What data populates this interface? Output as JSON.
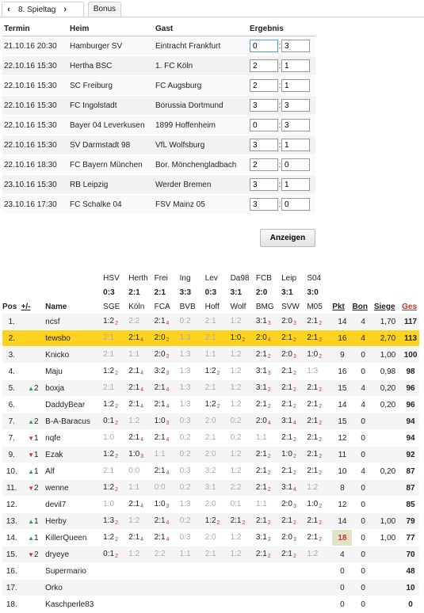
{
  "tabs": {
    "prev_icon": "‹",
    "matchday": "8. Spieltag",
    "next_icon": "›",
    "bonus": "Bonus"
  },
  "fixtures": {
    "headers": [
      "Termin",
      "Heim",
      "Gast",
      "Ergebnis"
    ],
    "rows": [
      {
        "date": "21.10.16 20:30",
        "home": "Hamburger SV",
        "away": "Eintracht Frankfurt",
        "h": "0",
        "a": "3"
      },
      {
        "date": "22.10.16 15:30",
        "home": "Hertha BSC",
        "away": "1. FC Köln",
        "h": "2",
        "a": "1"
      },
      {
        "date": "22.10.16 15:30",
        "home": "SC Freiburg",
        "away": "FC Augsburg",
        "h": "2",
        "a": "1"
      },
      {
        "date": "22.10.16 15:30",
        "home": "FC Ingolstadt",
        "away": "Borussia Dortmund",
        "h": "3",
        "a": "3"
      },
      {
        "date": "22.10.16 15:30",
        "home": "Bayer 04 Leverkusen",
        "away": "1899 Hoffenheim",
        "h": "0",
        "a": "3"
      },
      {
        "date": "22.10.16 15:30",
        "home": "SV Darmstadt 98",
        "away": "VfL Wolfsburg",
        "h": "3",
        "a": "1"
      },
      {
        "date": "22.10.16 18:30",
        "home": "FC Bayern München",
        "away": "Bor. Mönchengladbach",
        "h": "2",
        "a": "0"
      },
      {
        "date": "23.10.16 15:30",
        "home": "RB Leipzig",
        "away": "Werder Bremen",
        "h": "3",
        "a": "1"
      },
      {
        "date": "23.10.16 17:30",
        "home": "FC Schalke 04",
        "away": "FSV Mainz 05",
        "h": "3",
        "a": "0"
      }
    ],
    "submit": "Anzeigen"
  },
  "standings": {
    "match_headers": [
      {
        "t1": "HSV",
        "t2": "0:3",
        "t3": "SGE"
      },
      {
        "t1": "Herth",
        "t2": "2:1",
        "t3": "Köln"
      },
      {
        "t1": "Frei",
        "t2": "2:1",
        "t3": "FCA"
      },
      {
        "t1": "Ing",
        "t2": "3:3",
        "t3": "BVB"
      },
      {
        "t1": "Lev",
        "t2": "0:3",
        "t3": "Hoff"
      },
      {
        "t1": "Da98",
        "t2": "3:1",
        "t3": "Wolf"
      },
      {
        "t1": "FCB",
        "t2": "2:0",
        "t3": "BMG"
      },
      {
        "t1": "Leip",
        "t2": "3:1",
        "t3": "SVW"
      },
      {
        "t1": "S04",
        "t2": "3:0",
        "t3": "M05"
      }
    ],
    "col_pos": "Pos",
    "col_trend": "+/-",
    "col_name": "Name",
    "col_pkt": "Pkt",
    "col_bon": "Bon",
    "col_siege": "Siege",
    "col_ges": "Ges",
    "rows": [
      {
        "pos": "1.",
        "tr": "",
        "td": "",
        "name": "ncsf",
        "t": [
          [
            "1:2",
            "2",
            0
          ],
          [
            "2:2",
            "",
            1
          ],
          [
            "2:1",
            "4",
            0
          ],
          [
            "0:2",
            "",
            1
          ],
          [
            "2:1",
            "",
            1
          ],
          [
            "1:2",
            "",
            1
          ],
          [
            "3:1",
            "3",
            0
          ],
          [
            "2:0",
            "3",
            0
          ],
          [
            "2:1",
            "2",
            0
          ]
        ],
        "pkt": "14",
        "bon": "4",
        "siege": "1,70",
        "ges": "117"
      },
      {
        "pos": "2.",
        "tr": "",
        "td": "",
        "name": "tewsbo",
        "hl": true,
        "t": [
          [
            "2:1",
            "",
            1
          ],
          [
            "2:1",
            "4",
            0
          ],
          [
            "2:0",
            "2",
            0
          ],
          [
            "1:3",
            "",
            1
          ],
          [
            "2:1",
            "",
            1
          ],
          [
            "1:0",
            "2",
            0
          ],
          [
            "2:0",
            "4",
            0
          ],
          [
            "2:1",
            "2",
            0
          ],
          [
            "2:1",
            "2",
            0
          ]
        ],
        "pkt": "16",
        "bon": "4",
        "siege": "2,70",
        "ges": "113"
      },
      {
        "pos": "3.",
        "tr": "",
        "td": "",
        "name": "Knicko",
        "t": [
          [
            "2:1",
            "",
            1
          ],
          [
            "1:1",
            "",
            1
          ],
          [
            "2:0",
            "2",
            0
          ],
          [
            "1:3",
            "",
            1
          ],
          [
            "1:1",
            "",
            1
          ],
          [
            "1:2",
            "",
            1
          ],
          [
            "2:1",
            "2",
            0
          ],
          [
            "2:0",
            "3",
            0
          ],
          [
            "1:0",
            "2",
            0
          ]
        ],
        "pkt": "9",
        "bon": "0",
        "siege": "1,00",
        "ges": "100"
      },
      {
        "pos": "4.",
        "tr": "",
        "td": "",
        "name": "Maju",
        "t": [
          [
            "1:2",
            "2",
            0
          ],
          [
            "2:1",
            "4",
            0
          ],
          [
            "3:2",
            "3",
            0
          ],
          [
            "1:3",
            "",
            1
          ],
          [
            "1:2",
            "2",
            0
          ],
          [
            "1:2",
            "",
            1
          ],
          [
            "3:1",
            "3",
            0
          ],
          [
            "2:1",
            "2",
            0
          ],
          [
            "1:3",
            "",
            1
          ]
        ],
        "pkt": "16",
        "bon": "0",
        "siege": "0,98",
        "ges": "98"
      },
      {
        "pos": "5.",
        "tr": "up",
        "td": "2",
        "name": "boxja",
        "t": [
          [
            "2:1",
            "",
            1
          ],
          [
            "2:1",
            "4",
            0
          ],
          [
            "2:1",
            "4",
            0
          ],
          [
            "1:3",
            "",
            1
          ],
          [
            "2:1",
            "",
            1
          ],
          [
            "1:2",
            "",
            1
          ],
          [
            "3:1",
            "2",
            0
          ],
          [
            "2:1",
            "2",
            0
          ],
          [
            "2:1",
            "2",
            0
          ]
        ],
        "pkt": "15",
        "bon": "4",
        "siege": "0,20",
        "ges": "96"
      },
      {
        "pos": "6.",
        "tr": "",
        "td": "",
        "name": "DaddyBear",
        "t": [
          [
            "1:2",
            "2",
            0
          ],
          [
            "2:1",
            "4",
            0
          ],
          [
            "2:1",
            "4",
            0
          ],
          [
            "1:3",
            "",
            1
          ],
          [
            "1:2",
            "2",
            0
          ],
          [
            "1:2",
            "",
            1
          ],
          [
            "2:1",
            "2",
            0
          ],
          [
            "2:1",
            "2",
            0
          ],
          [
            "2:1",
            "2",
            0
          ]
        ],
        "pkt": "14",
        "bon": "4",
        "siege": "0,20",
        "ges": "96"
      },
      {
        "pos": "7.",
        "tr": "up",
        "td": "2",
        "name": "B-A-Baracus",
        "t": [
          [
            "0:1",
            "2",
            0
          ],
          [
            "1:2",
            "",
            1
          ],
          [
            "1:0",
            "3",
            0
          ],
          [
            "0:3",
            "",
            1
          ],
          [
            "2:0",
            "",
            1
          ],
          [
            "0:2",
            "",
            1
          ],
          [
            "2:0",
            "4",
            0
          ],
          [
            "3:1",
            "4",
            0
          ],
          [
            "2:1",
            "2",
            0
          ]
        ],
        "pkt": "15",
        "bon": "0",
        "siege": "",
        "ges": "94"
      },
      {
        "pos": "7.",
        "tr": "dn",
        "td": "1",
        "name": "nqfe",
        "t": [
          [
            "1:0",
            "",
            1
          ],
          [
            "2:1",
            "4",
            0
          ],
          [
            "2:1",
            "4",
            0
          ],
          [
            "0:2",
            "",
            1
          ],
          [
            "2:1",
            "",
            1
          ],
          [
            "0:2",
            "",
            1
          ],
          [
            "1:1",
            "",
            1
          ],
          [
            "2:1",
            "2",
            0
          ],
          [
            "2:1",
            "2",
            0
          ]
        ],
        "pkt": "12",
        "bon": "0",
        "siege": "",
        "ges": "94"
      },
      {
        "pos": "9.",
        "tr": "dn",
        "td": "1",
        "name": "Ezak",
        "t": [
          [
            "1:2",
            "2",
            0
          ],
          [
            "1:0",
            "3",
            0
          ],
          [
            "1:1",
            "",
            1
          ],
          [
            "0:2",
            "",
            1
          ],
          [
            "2:0",
            "",
            1
          ],
          [
            "1:2",
            "",
            1
          ],
          [
            "2:1",
            "2",
            0
          ],
          [
            "1:0",
            "2",
            0
          ],
          [
            "2:1",
            "2",
            0
          ]
        ],
        "pkt": "11",
        "bon": "0",
        "siege": "",
        "ges": "92"
      },
      {
        "pos": "10.",
        "tr": "up",
        "td": "1",
        "name": "Alf",
        "t": [
          [
            "2:1",
            "",
            1
          ],
          [
            "0:0",
            "",
            1
          ],
          [
            "2:1",
            "4",
            0
          ],
          [
            "0:3",
            "",
            1
          ],
          [
            "3:2",
            "",
            1
          ],
          [
            "1:2",
            "",
            1
          ],
          [
            "2:1",
            "2",
            0
          ],
          [
            "2:1",
            "2",
            0
          ],
          [
            "2:1",
            "2",
            0
          ]
        ],
        "pkt": "10",
        "bon": "4",
        "siege": "0,20",
        "ges": "87"
      },
      {
        "pos": "11.",
        "tr": "dn",
        "td": "2",
        "name": "wenne",
        "t": [
          [
            "1:2",
            "2",
            0
          ],
          [
            "1:1",
            "",
            1
          ],
          [
            "0:0",
            "",
            1
          ],
          [
            "0:2",
            "",
            1
          ],
          [
            "3:1",
            "",
            1
          ],
          [
            "2:2",
            "",
            1
          ],
          [
            "2:1",
            "2",
            0
          ],
          [
            "3:1",
            "4",
            0
          ],
          [
            "1:2",
            "",
            1
          ]
        ],
        "pkt": "8",
        "bon": "0",
        "siege": "",
        "ges": "87"
      },
      {
        "pos": "12.",
        "tr": "",
        "td": "",
        "name": "devil7",
        "t": [
          [
            "1:0",
            "",
            1
          ],
          [
            "2:1",
            "4",
            0
          ],
          [
            "1:0",
            "3",
            0
          ],
          [
            "1:3",
            "",
            1
          ],
          [
            "2:0",
            "",
            1
          ],
          [
            "0:1",
            "",
            1
          ],
          [
            "1:1",
            "",
            1
          ],
          [
            "2:0",
            "3",
            0
          ],
          [
            "1:0",
            "2",
            0
          ]
        ],
        "pkt": "12",
        "bon": "0",
        "siege": "",
        "ges": "85"
      },
      {
        "pos": "13.",
        "tr": "up",
        "td": "1",
        "name": "Herby",
        "t": [
          [
            "1:3",
            "2",
            0
          ],
          [
            "1:2",
            "",
            1
          ],
          [
            "2:1",
            "4",
            0
          ],
          [
            "0:2",
            "",
            1
          ],
          [
            "1:2",
            "2",
            0
          ],
          [
            "2:1",
            "2",
            0
          ],
          [
            "2:1",
            "2",
            0
          ],
          [
            "2:1",
            "2",
            0
          ],
          [
            "2:1",
            "2",
            0
          ]
        ],
        "pkt": "14",
        "bon": "0",
        "siege": "1,00",
        "ges": "79"
      },
      {
        "pos": "14.",
        "tr": "up",
        "td": "1",
        "name": "KillerQueen",
        "t": [
          [
            "1:2",
            "2",
            0
          ],
          [
            "2:1",
            "4",
            0
          ],
          [
            "2:1",
            "4",
            0
          ],
          [
            "0:3",
            "",
            1
          ],
          [
            "2:0",
            "",
            1
          ],
          [
            "1:2",
            "",
            1
          ],
          [
            "3:1",
            "3",
            0
          ],
          [
            "2:0",
            "3",
            0
          ],
          [
            "2:1",
            "2",
            0
          ]
        ],
        "pkt": "18",
        "pkthl": true,
        "bon": "0",
        "siege": "1,00",
        "ges": "77"
      },
      {
        "pos": "15.",
        "tr": "dn",
        "td": "2",
        "name": "dryeye",
        "t": [
          [
            "0:1",
            "2",
            0
          ],
          [
            "1:2",
            "",
            1
          ],
          [
            "2:2",
            "",
            1
          ],
          [
            "1:1",
            "",
            1
          ],
          [
            "2:1",
            "",
            1
          ],
          [
            "1:2",
            "",
            1
          ],
          [
            "2:1",
            "2",
            0
          ],
          [
            "2:1",
            "2",
            0
          ],
          [
            "1:2",
            "",
            1
          ]
        ],
        "pkt": "4",
        "bon": "0",
        "siege": "",
        "ges": "70"
      },
      {
        "pos": "16.",
        "tr": "",
        "td": "",
        "name": "Supermario",
        "t": [],
        "pkt": "0",
        "bon": "0",
        "siege": "",
        "ges": "48"
      },
      {
        "pos": "17.",
        "tr": "",
        "td": "",
        "name": "Orko",
        "t": [],
        "pkt": "0",
        "bon": "0",
        "siege": "",
        "ges": "10"
      },
      {
        "pos": "18.",
        "tr": "",
        "td": "",
        "name": "Kaschperle83",
        "t": [],
        "pkt": "0",
        "bon": "0",
        "siege": "",
        "ges": "0"
      }
    ]
  }
}
